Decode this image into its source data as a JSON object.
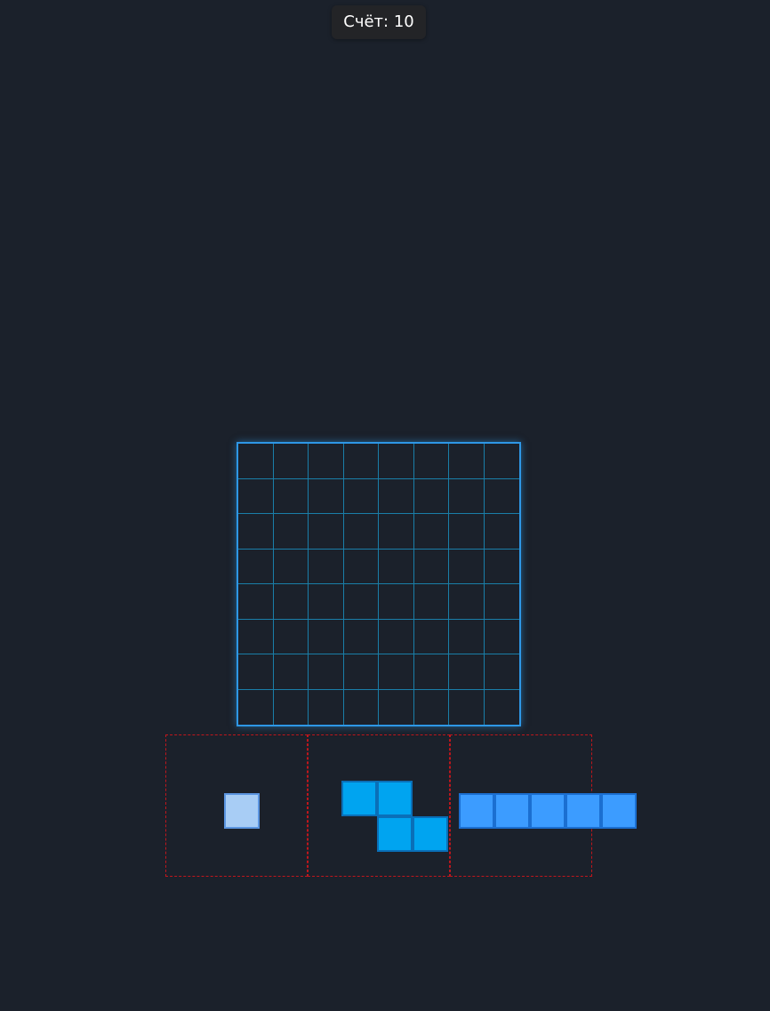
{
  "score": {
    "text": "Счёт: 10"
  },
  "board": {
    "rows": 8,
    "cols": 8,
    "border_color": "#2e97e6",
    "grid_color": "#1a7ea8"
  },
  "trays": [
    {
      "name": "tray-1",
      "piece": {
        "shape": "single",
        "cells": [
          [
            0,
            0
          ]
        ],
        "fill": "#a8cdf5",
        "stroke": "#5b95e0"
      }
    },
    {
      "name": "tray-2",
      "piece": {
        "shape": "z",
        "cells": [
          [
            0,
            0
          ],
          [
            0,
            1
          ],
          [
            1,
            1
          ],
          [
            1,
            2
          ]
        ],
        "fill": "#00a4f0",
        "stroke": "#0a6fb8"
      }
    },
    {
      "name": "tray-3",
      "piece": {
        "shape": "line-5",
        "cells": [
          [
            0,
            0
          ],
          [
            0,
            1
          ],
          [
            0,
            2
          ],
          [
            0,
            3
          ],
          [
            0,
            4
          ]
        ],
        "fill": "#3c9cff",
        "stroke": "#1b6fd1"
      }
    }
  ]
}
